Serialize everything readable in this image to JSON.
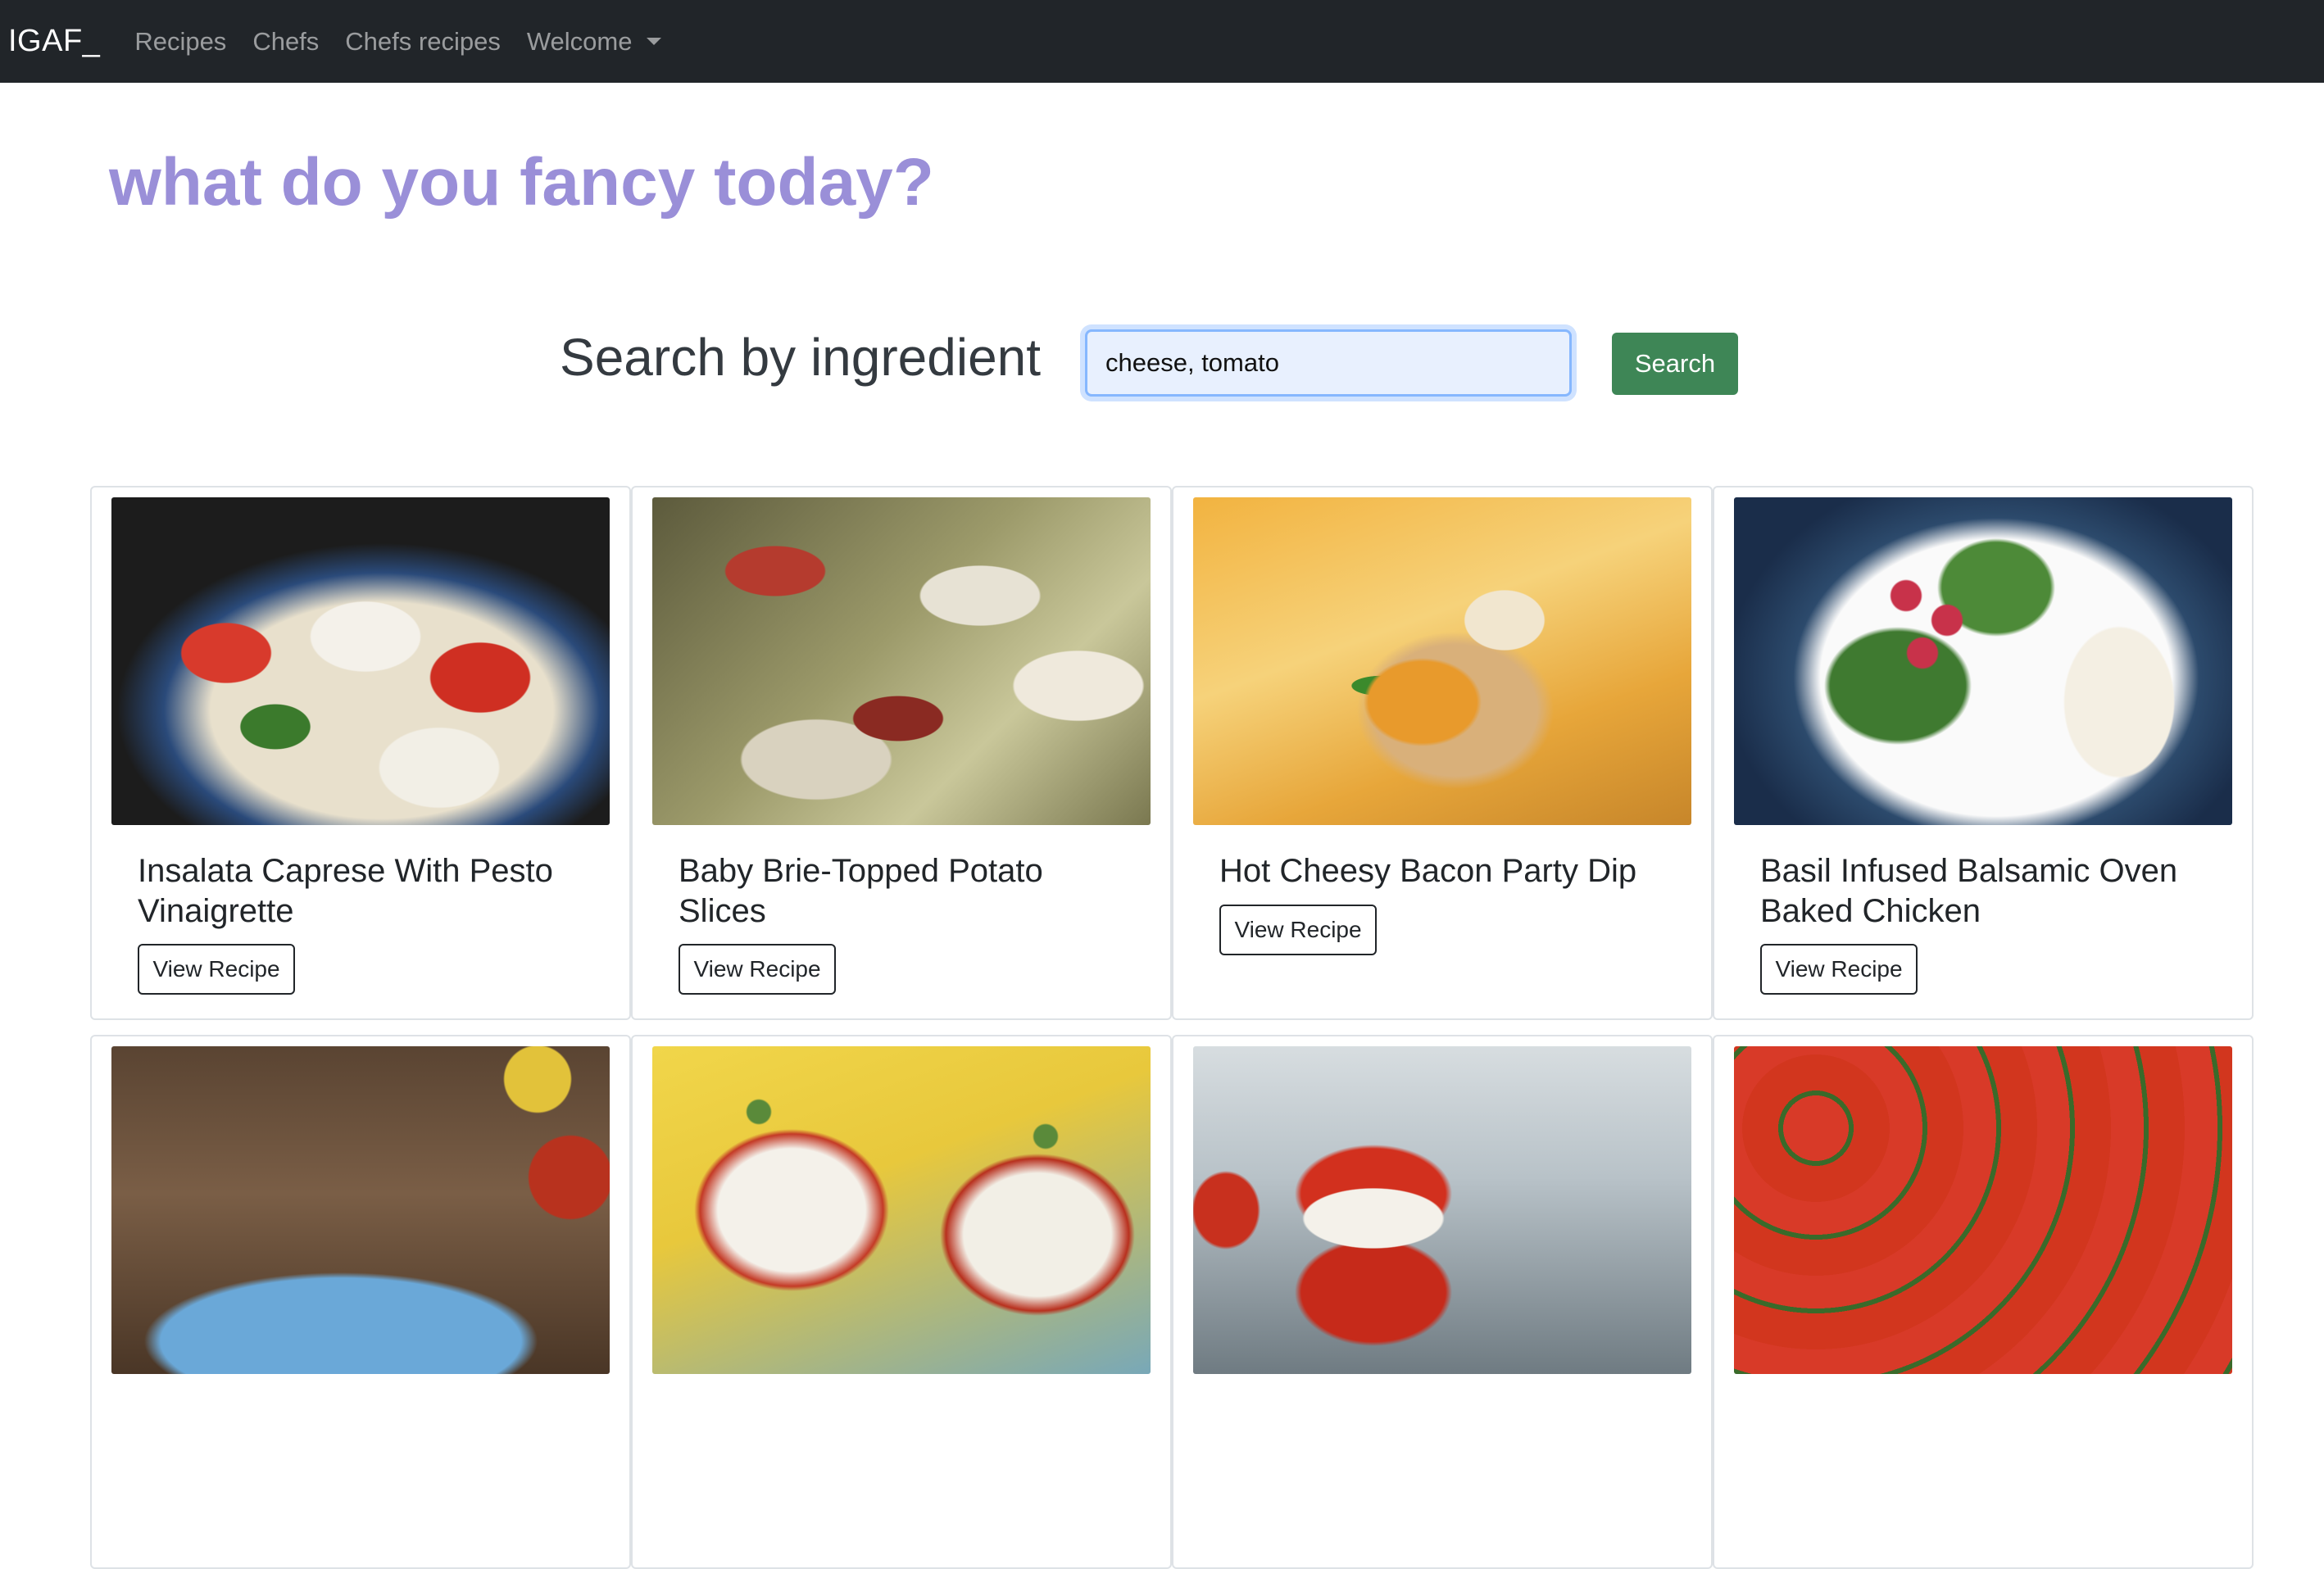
{
  "navbar": {
    "brand": "IGAF_",
    "links": [
      {
        "label": "Recipes"
      },
      {
        "label": "Chefs"
      },
      {
        "label": "Chefs recipes"
      },
      {
        "label": "Welcome"
      }
    ],
    "dropdown_icon": "caret-down-icon"
  },
  "page": {
    "title": "what do you fancy today?",
    "title_color": "#9a8fd8"
  },
  "search": {
    "label": "Search by ingredient",
    "value": "cheese, tomato",
    "button_label": "Search",
    "button_color": "#3e8656"
  },
  "recipes": [
    {
      "title": "Insalata Caprese With Pesto Vinaigrette",
      "button_label": "View Recipe"
    },
    {
      "title": "Baby Brie-Topped Potato Slices",
      "button_label": "View Recipe"
    },
    {
      "title": "Hot Cheesy Bacon Party Dip",
      "button_label": "View Recipe"
    },
    {
      "title": "Basil Infused Balsamic Oven Baked Chicken",
      "button_label": "View Recipe"
    },
    {
      "title": "",
      "button_label": ""
    },
    {
      "title": "",
      "button_label": ""
    },
    {
      "title": "",
      "button_label": ""
    },
    {
      "title": "",
      "button_label": ""
    }
  ]
}
